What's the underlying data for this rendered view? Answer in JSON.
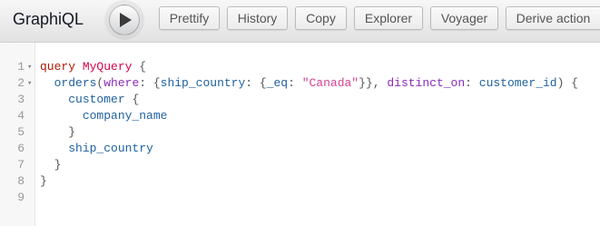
{
  "app": {
    "title": "GraphiQL"
  },
  "toolbar": {
    "execute_icon": "play-icon",
    "buttons": [
      "Prettify",
      "History",
      "Copy",
      "Explorer",
      "Voyager",
      "Derive action"
    ]
  },
  "editor": {
    "fold_icon": "fold-arrow-icon",
    "lines": [
      {
        "number": "1",
        "foldable": true,
        "tokens": [
          {
            "t": "query",
            "c": "kw"
          },
          {
            "t": " ",
            "c": "p"
          },
          {
            "t": "MyQuery",
            "c": "def"
          },
          {
            "t": " {",
            "c": "p"
          }
        ]
      },
      {
        "number": "2",
        "foldable": true,
        "tokens": [
          {
            "t": "  ",
            "c": "p"
          },
          {
            "t": "orders",
            "c": "fld"
          },
          {
            "t": "(",
            "c": "p"
          },
          {
            "t": "where",
            "c": "attr"
          },
          {
            "t": ": {",
            "c": "p"
          },
          {
            "t": "ship_country",
            "c": "fld"
          },
          {
            "t": ": {",
            "c": "p"
          },
          {
            "t": "_eq",
            "c": "fld"
          },
          {
            "t": ": ",
            "c": "p"
          },
          {
            "t": "\"Canada\"",
            "c": "str"
          },
          {
            "t": "}}, ",
            "c": "p"
          },
          {
            "t": "distinct_on",
            "c": "attr"
          },
          {
            "t": ": ",
            "c": "p"
          },
          {
            "t": "customer_id",
            "c": "fld"
          },
          {
            "t": ") {",
            "c": "p"
          }
        ]
      },
      {
        "number": "3",
        "foldable": false,
        "tokens": [
          {
            "t": "    ",
            "c": "p"
          },
          {
            "t": "customer",
            "c": "fld"
          },
          {
            "t": " {",
            "c": "p"
          }
        ]
      },
      {
        "number": "4",
        "foldable": false,
        "tokens": [
          {
            "t": "      ",
            "c": "p"
          },
          {
            "t": "company_name",
            "c": "fld"
          }
        ]
      },
      {
        "number": "5",
        "foldable": false,
        "tokens": [
          {
            "t": "    }",
            "c": "p"
          }
        ]
      },
      {
        "number": "6",
        "foldable": false,
        "tokens": [
          {
            "t": "    ",
            "c": "p"
          },
          {
            "t": "ship_country",
            "c": "fld"
          }
        ]
      },
      {
        "number": "7",
        "foldable": false,
        "tokens": [
          {
            "t": "  }",
            "c": "p"
          }
        ]
      },
      {
        "number": "8",
        "foldable": false,
        "tokens": [
          {
            "t": "}",
            "c": "p"
          }
        ]
      },
      {
        "number": "9",
        "foldable": false,
        "tokens": []
      }
    ]
  }
}
